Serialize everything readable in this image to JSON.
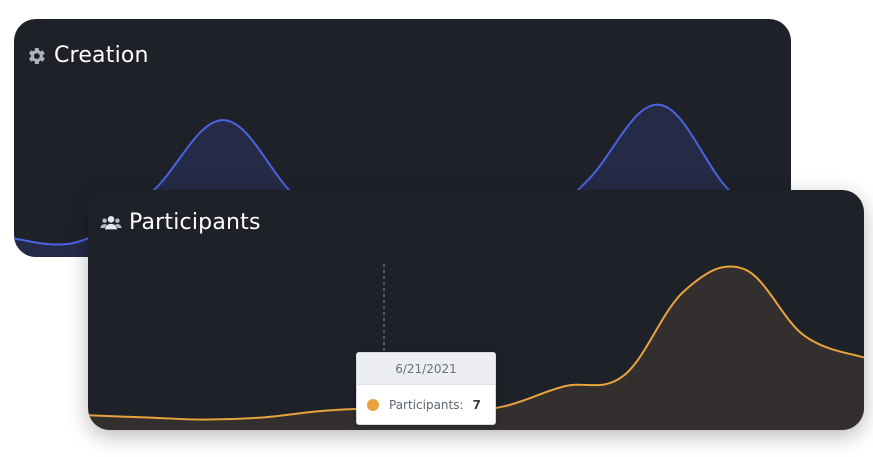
{
  "colors": {
    "card_bg": "#1f2129",
    "creation_line": "#4a63e0",
    "creation_fill": "#252a46",
    "participants_line": "#e8a33c",
    "participants_fill": "#332f2e"
  },
  "cards": {
    "creation": {
      "title": "Creation",
      "icon": "gear-icon"
    },
    "participants": {
      "title": "Participants",
      "icon": "users-icon"
    }
  },
  "tooltip": {
    "date": "6/21/2021",
    "series_label": "Participants:",
    "value": "7"
  },
  "chart_data": [
    {
      "type": "area",
      "title": "Creation",
      "series": [
        {
          "values": [
            0.9,
            0.6,
            3.8,
            8.5,
            3.5,
            0.3,
            0.2,
            0.4,
            4.5,
            9.5,
            3.8,
            0.9
          ]
        }
      ],
      "ylim": [
        0,
        10
      ],
      "grid": false,
      "legend": "none"
    },
    {
      "type": "area",
      "title": "Participants",
      "series": [
        {
          "name": "Participants",
          "values": [
            4,
            3,
            2,
            3,
            6,
            7,
            5,
            8,
            17,
            22,
            60,
            70,
            40,
            30
          ]
        }
      ],
      "highlight": {
        "index": 5,
        "label": "6/21/2021",
        "value": 7
      },
      "ylim": [
        0,
        75
      ],
      "grid": false,
      "legend": "none"
    }
  ]
}
